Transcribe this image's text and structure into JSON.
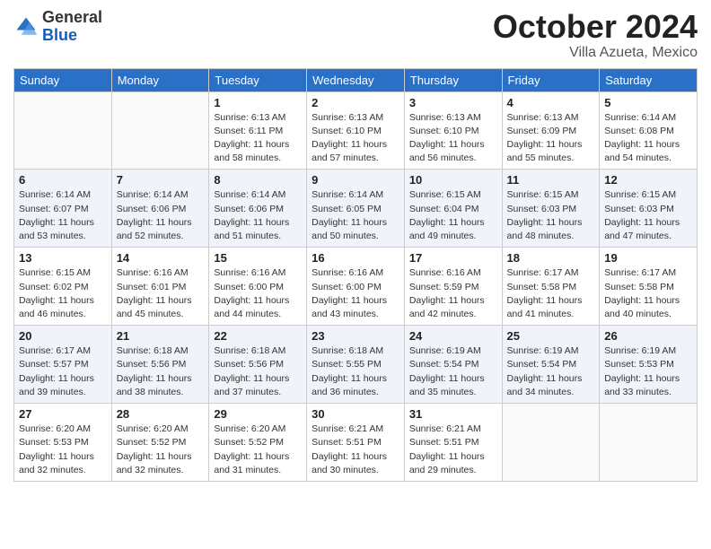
{
  "logo": {
    "general": "General",
    "blue": "Blue"
  },
  "title": {
    "month": "October 2024",
    "location": "Villa Azueta, Mexico"
  },
  "weekdays": [
    "Sunday",
    "Monday",
    "Tuesday",
    "Wednesday",
    "Thursday",
    "Friday",
    "Saturday"
  ],
  "weeks": [
    [
      {
        "day": "",
        "sunrise": "",
        "sunset": "",
        "daylight": ""
      },
      {
        "day": "",
        "sunrise": "",
        "sunset": "",
        "daylight": ""
      },
      {
        "day": "1",
        "sunrise": "Sunrise: 6:13 AM",
        "sunset": "Sunset: 6:11 PM",
        "daylight": "Daylight: 11 hours and 58 minutes."
      },
      {
        "day": "2",
        "sunrise": "Sunrise: 6:13 AM",
        "sunset": "Sunset: 6:10 PM",
        "daylight": "Daylight: 11 hours and 57 minutes."
      },
      {
        "day": "3",
        "sunrise": "Sunrise: 6:13 AM",
        "sunset": "Sunset: 6:10 PM",
        "daylight": "Daylight: 11 hours and 56 minutes."
      },
      {
        "day": "4",
        "sunrise": "Sunrise: 6:13 AM",
        "sunset": "Sunset: 6:09 PM",
        "daylight": "Daylight: 11 hours and 55 minutes."
      },
      {
        "day": "5",
        "sunrise": "Sunrise: 6:14 AM",
        "sunset": "Sunset: 6:08 PM",
        "daylight": "Daylight: 11 hours and 54 minutes."
      }
    ],
    [
      {
        "day": "6",
        "sunrise": "Sunrise: 6:14 AM",
        "sunset": "Sunset: 6:07 PM",
        "daylight": "Daylight: 11 hours and 53 minutes."
      },
      {
        "day": "7",
        "sunrise": "Sunrise: 6:14 AM",
        "sunset": "Sunset: 6:06 PM",
        "daylight": "Daylight: 11 hours and 52 minutes."
      },
      {
        "day": "8",
        "sunrise": "Sunrise: 6:14 AM",
        "sunset": "Sunset: 6:06 PM",
        "daylight": "Daylight: 11 hours and 51 minutes."
      },
      {
        "day": "9",
        "sunrise": "Sunrise: 6:14 AM",
        "sunset": "Sunset: 6:05 PM",
        "daylight": "Daylight: 11 hours and 50 minutes."
      },
      {
        "day": "10",
        "sunrise": "Sunrise: 6:15 AM",
        "sunset": "Sunset: 6:04 PM",
        "daylight": "Daylight: 11 hours and 49 minutes."
      },
      {
        "day": "11",
        "sunrise": "Sunrise: 6:15 AM",
        "sunset": "Sunset: 6:03 PM",
        "daylight": "Daylight: 11 hours and 48 minutes."
      },
      {
        "day": "12",
        "sunrise": "Sunrise: 6:15 AM",
        "sunset": "Sunset: 6:03 PM",
        "daylight": "Daylight: 11 hours and 47 minutes."
      }
    ],
    [
      {
        "day": "13",
        "sunrise": "Sunrise: 6:15 AM",
        "sunset": "Sunset: 6:02 PM",
        "daylight": "Daylight: 11 hours and 46 minutes."
      },
      {
        "day": "14",
        "sunrise": "Sunrise: 6:16 AM",
        "sunset": "Sunset: 6:01 PM",
        "daylight": "Daylight: 11 hours and 45 minutes."
      },
      {
        "day": "15",
        "sunrise": "Sunrise: 6:16 AM",
        "sunset": "Sunset: 6:00 PM",
        "daylight": "Daylight: 11 hours and 44 minutes."
      },
      {
        "day": "16",
        "sunrise": "Sunrise: 6:16 AM",
        "sunset": "Sunset: 6:00 PM",
        "daylight": "Daylight: 11 hours and 43 minutes."
      },
      {
        "day": "17",
        "sunrise": "Sunrise: 6:16 AM",
        "sunset": "Sunset: 5:59 PM",
        "daylight": "Daylight: 11 hours and 42 minutes."
      },
      {
        "day": "18",
        "sunrise": "Sunrise: 6:17 AM",
        "sunset": "Sunset: 5:58 PM",
        "daylight": "Daylight: 11 hours and 41 minutes."
      },
      {
        "day": "19",
        "sunrise": "Sunrise: 6:17 AM",
        "sunset": "Sunset: 5:58 PM",
        "daylight": "Daylight: 11 hours and 40 minutes."
      }
    ],
    [
      {
        "day": "20",
        "sunrise": "Sunrise: 6:17 AM",
        "sunset": "Sunset: 5:57 PM",
        "daylight": "Daylight: 11 hours and 39 minutes."
      },
      {
        "day": "21",
        "sunrise": "Sunrise: 6:18 AM",
        "sunset": "Sunset: 5:56 PM",
        "daylight": "Daylight: 11 hours and 38 minutes."
      },
      {
        "day": "22",
        "sunrise": "Sunrise: 6:18 AM",
        "sunset": "Sunset: 5:56 PM",
        "daylight": "Daylight: 11 hours and 37 minutes."
      },
      {
        "day": "23",
        "sunrise": "Sunrise: 6:18 AM",
        "sunset": "Sunset: 5:55 PM",
        "daylight": "Daylight: 11 hours and 36 minutes."
      },
      {
        "day": "24",
        "sunrise": "Sunrise: 6:19 AM",
        "sunset": "Sunset: 5:54 PM",
        "daylight": "Daylight: 11 hours and 35 minutes."
      },
      {
        "day": "25",
        "sunrise": "Sunrise: 6:19 AM",
        "sunset": "Sunset: 5:54 PM",
        "daylight": "Daylight: 11 hours and 34 minutes."
      },
      {
        "day": "26",
        "sunrise": "Sunrise: 6:19 AM",
        "sunset": "Sunset: 5:53 PM",
        "daylight": "Daylight: 11 hours and 33 minutes."
      }
    ],
    [
      {
        "day": "27",
        "sunrise": "Sunrise: 6:20 AM",
        "sunset": "Sunset: 5:53 PM",
        "daylight": "Daylight: 11 hours and 32 minutes."
      },
      {
        "day": "28",
        "sunrise": "Sunrise: 6:20 AM",
        "sunset": "Sunset: 5:52 PM",
        "daylight": "Daylight: 11 hours and 32 minutes."
      },
      {
        "day": "29",
        "sunrise": "Sunrise: 6:20 AM",
        "sunset": "Sunset: 5:52 PM",
        "daylight": "Daylight: 11 hours and 31 minutes."
      },
      {
        "day": "30",
        "sunrise": "Sunrise: 6:21 AM",
        "sunset": "Sunset: 5:51 PM",
        "daylight": "Daylight: 11 hours and 30 minutes."
      },
      {
        "day": "31",
        "sunrise": "Sunrise: 6:21 AM",
        "sunset": "Sunset: 5:51 PM",
        "daylight": "Daylight: 11 hours and 29 minutes."
      },
      {
        "day": "",
        "sunrise": "",
        "sunset": "",
        "daylight": ""
      },
      {
        "day": "",
        "sunrise": "",
        "sunset": "",
        "daylight": ""
      }
    ]
  ]
}
